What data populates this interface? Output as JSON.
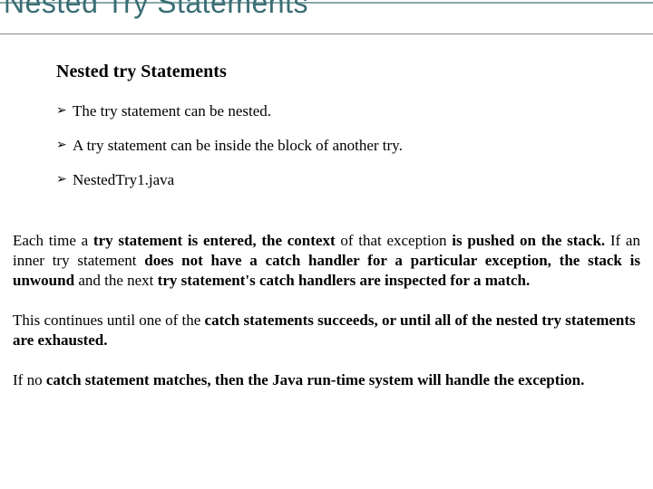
{
  "title": "Nested Try Statements",
  "subheading": "Nested try Statements",
  "bullets": [
    "The try statement can be nested.",
    "A try statement can be inside the block of another try.",
    "NestedTry1.java"
  ],
  "para1": {
    "lead": "Each time a ",
    "b1": "try statement is entered, the context ",
    "r1": "of that exception ",
    "b2": "is pushed on the stack. ",
    "r2": "If an inner try statement ",
    "b3": "does not have a catch handler for a particular exception, the stack is unwound ",
    "r3": "and the next ",
    "b4": "try statement's catch handlers are inspected for a match."
  },
  "para2": {
    "r1": "This continues until one of the ",
    "b1": "catch statements succeeds, or until all of the nested try statements are exhausted."
  },
  "para3": {
    "r1": "If no ",
    "b1": "catch statement matches, then the Java run-time system will handle the exception."
  }
}
